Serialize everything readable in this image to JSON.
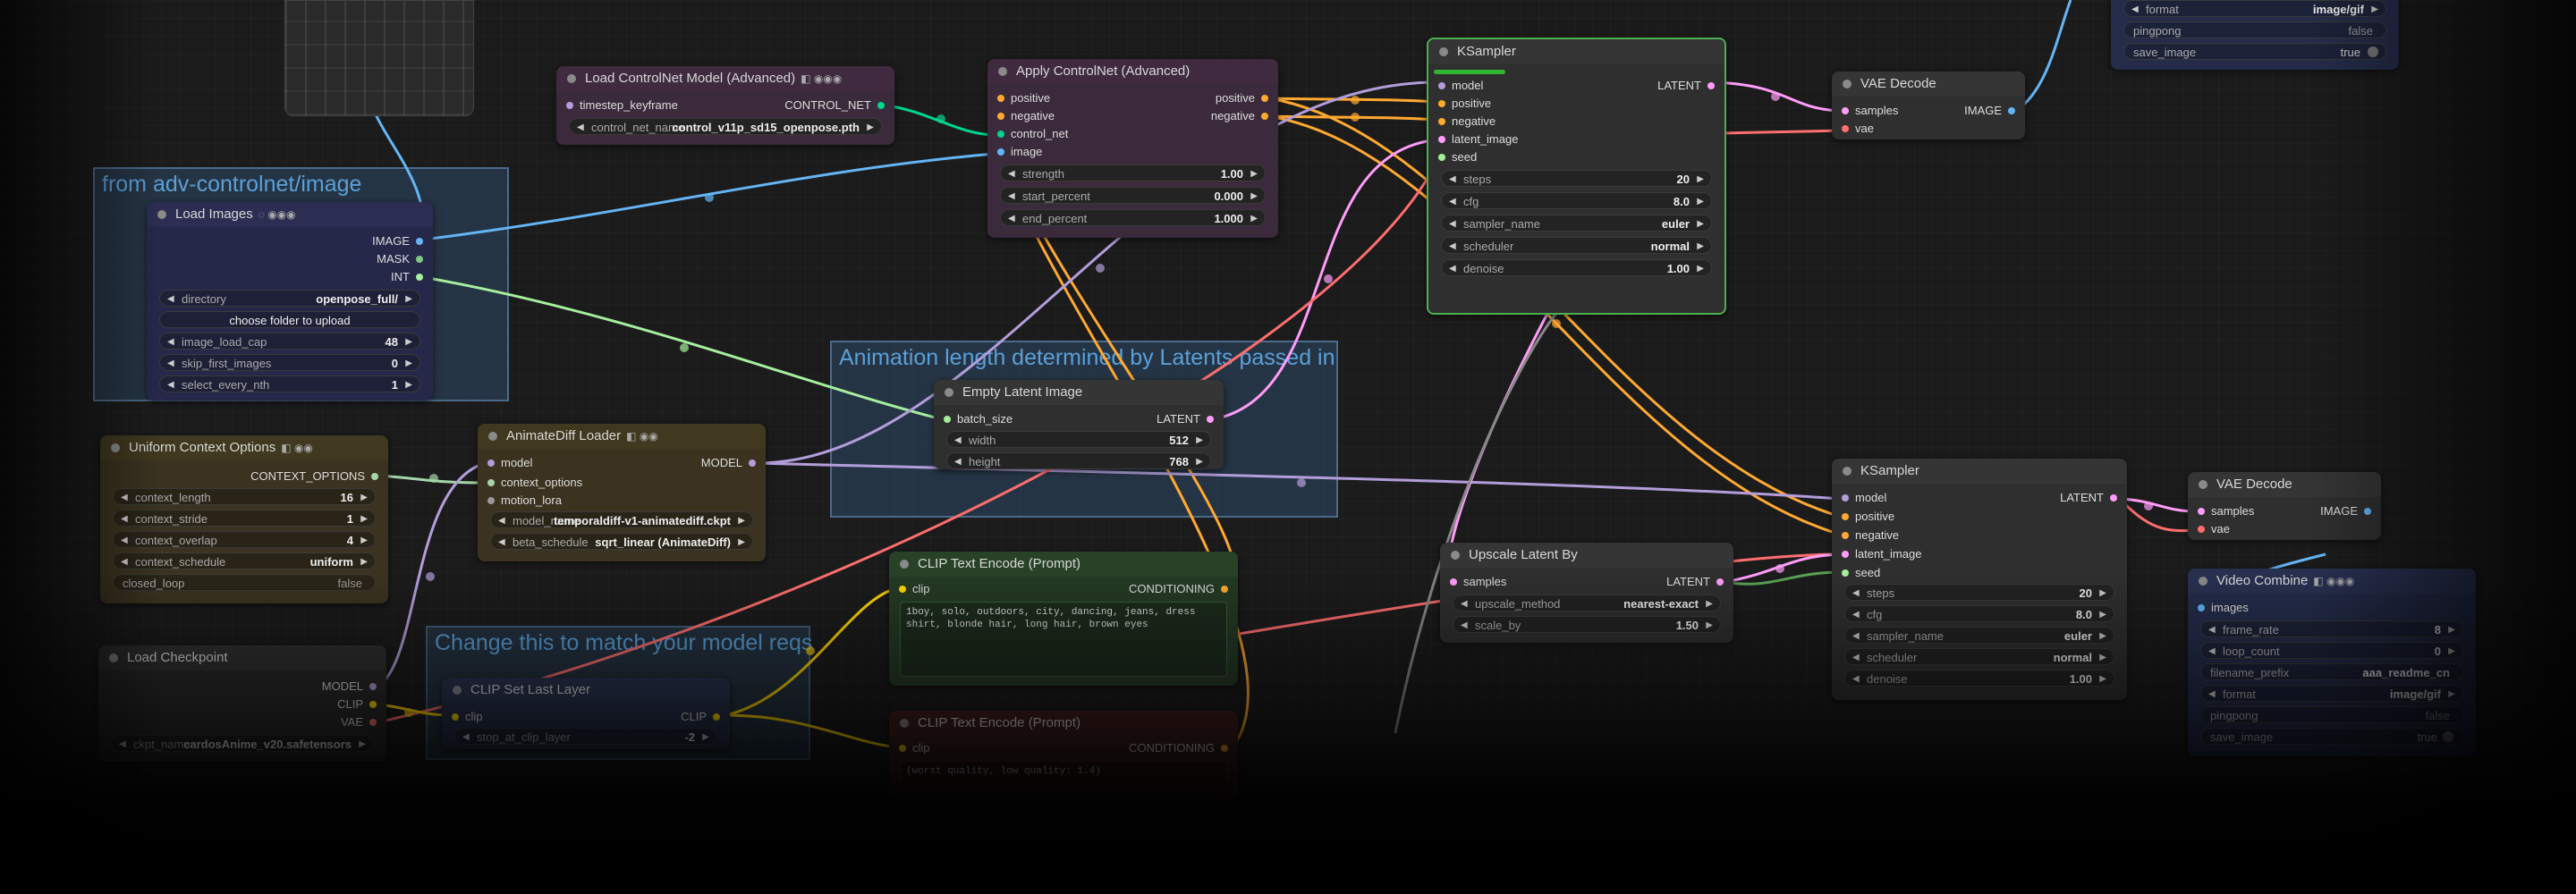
{
  "colors": {
    "image": "#64b5f6",
    "latent": "#ff9cf9",
    "model": "#b39ddb",
    "conditioning": "#ffa931",
    "clip": "#ffd500",
    "vae": "#ff6e6e",
    "controlnet": "#00d78d",
    "context": "#a5d6a7",
    "int": "#a6ee9e",
    "mask": "#81c784"
  },
  "groups": {
    "image": {
      "title": "from adv-controlnet/image"
    },
    "latent": {
      "title": "Animation length determined by Latents passed in"
    },
    "model": {
      "title": "Change this to match your model reqs"
    }
  },
  "nodes": {
    "load_controlnet": {
      "title": "Load ControlNet Model (Advanced)",
      "badges": "◧ ◉◉◉",
      "in_timestep": "timestep_keyframe",
      "out": "CONTROL_NET",
      "w_name": "control_net_name",
      "w_value": "control_v11p_sd15_openpose.pth"
    },
    "apply_controlnet": {
      "title": "Apply ControlNet (Advanced)",
      "in_positive": "positive",
      "in_negative": "negative",
      "in_control_net": "control_net",
      "in_image": "image",
      "out_positive": "positive",
      "out_negative": "negative",
      "strength_name": "strength",
      "strength": "1.00",
      "start_name": "start_percent",
      "start": "0.000",
      "end_name": "end_percent",
      "end": "1.000"
    },
    "ksampler1": {
      "title": "KSampler",
      "in_model": "model",
      "in_positive": "positive",
      "in_negative": "negative",
      "in_latent": "latent_image",
      "in_seed": "seed",
      "out": "LATENT",
      "steps_name": "steps",
      "steps": "20",
      "cfg_name": "cfg",
      "cfg": "8.0",
      "sampler_name": "sampler_name",
      "sampler": "euler",
      "scheduler_name": "scheduler",
      "scheduler": "normal",
      "denoise_name": "denoise",
      "denoise": "1.00"
    },
    "vae_decode1": {
      "title": "VAE Decode",
      "in_samples": "samples",
      "in_vae": "vae",
      "out": "IMAGE"
    },
    "top_video": {
      "format_name": "format",
      "format": "image/gif",
      "pingpong_name": "pingpong",
      "pingpong": "false",
      "save_name": "save_image",
      "save": "true"
    },
    "load_images": {
      "title": "Load Images",
      "badges": "◌ ◉◉◉",
      "out_image": "IMAGE",
      "out_mask": "MASK",
      "out_int": "INT",
      "dir_name": "directory",
      "dir": "openpose_full/",
      "upload": "choose folder to upload",
      "cap_name": "image_load_cap",
      "cap": "48",
      "skip_name": "skip_first_images",
      "skip": "0",
      "nth_name": "select_every_nth",
      "nth": "1"
    },
    "empty_latent": {
      "title": "Empty Latent Image",
      "in_batch": "batch_size",
      "out": "LATENT",
      "width_name": "width",
      "width": "512",
      "height_name": "height",
      "height": "768"
    },
    "uniform_context": {
      "title": "Uniform Context Options",
      "badges": "◧ ◉◉",
      "out": "CONTEXT_OPTIONS",
      "len_name": "context_length",
      "len": "16",
      "stride_name": "context_stride",
      "stride": "1",
      "overlap_name": "context_overlap",
      "overlap": "4",
      "sched_name": "context_schedule",
      "sched": "uniform",
      "loop_name": "closed_loop",
      "loop": "false"
    },
    "animatediff": {
      "title": "AnimateDiff Loader",
      "badges": "◧ ◉◉",
      "in_model": "model",
      "in_context": "context_options",
      "in_motion": "motion_lora",
      "out": "MODEL",
      "model_name_label": "model_name",
      "model_name": "temporaldiff-v1-animatediff.ckpt",
      "beta_name": "beta_schedule",
      "beta": "sqrt_linear (AnimateDiff)"
    },
    "clip_pos": {
      "title": "CLIP Text Encode (Prompt)",
      "in_clip": "clip",
      "out": "CONDITIONING",
      "text": "1boy, solo, outdoors, city, dancing, jeans, dress shirt, blonde hair, long hair, brown eyes"
    },
    "clip_neg": {
      "title": "CLIP Text Encode (Prompt)",
      "in_clip": "clip",
      "out": "CONDITIONING",
      "text": "(worst quality, low quality: 1.4)"
    },
    "checkpoint": {
      "title": "Load Checkpoint",
      "out_model": "MODEL",
      "out_clip": "CLIP",
      "out_vae": "VAE",
      "ckpt_name": "ckpt_name",
      "ckpt": "cardosAnime_v20.safetensors"
    },
    "clip_skip": {
      "title": "CLIP Set Last Layer",
      "in_clip": "clip",
      "out": "CLIP",
      "w_name": "stop_at_clip_layer",
      "w_value": "-2"
    },
    "upscale": {
      "title": "Upscale Latent By",
      "in_samples": "samples",
      "out": "LATENT",
      "method_name": "upscale_method",
      "method": "nearest-exact",
      "scale_name": "scale_by",
      "scale": "1.50"
    },
    "ksampler2": {
      "title": "KSampler",
      "in_model": "model",
      "in_positive": "positive",
      "in_negative": "negative",
      "in_latent": "latent_image",
      "in_seed": "seed",
      "out": "LATENT",
      "steps_name": "steps",
      "steps": "20",
      "cfg_name": "cfg",
      "cfg": "8.0",
      "sampler_name": "sampler_name",
      "sampler": "euler",
      "scheduler_name": "scheduler",
      "scheduler": "normal",
      "denoise_name": "denoise",
      "denoise": "1.00"
    },
    "vae_decode2": {
      "title": "VAE Decode",
      "in_samples": "samples",
      "in_vae": "vae",
      "out": "IMAGE"
    },
    "video_combine": {
      "title": "Video Combine",
      "badges": "◧ ◉◉◉",
      "in_images": "images",
      "fr_name": "frame_rate",
      "fr": "8",
      "loop_name": "loop_count",
      "loop": "0",
      "prefix_name": "filename_prefix",
      "prefix": "aaa_readme_cn",
      "format_name": "format",
      "format": "image/gif",
      "pp_name": "pingpong",
      "pp": "false",
      "save_name": "save_image",
      "save": "true"
    }
  }
}
